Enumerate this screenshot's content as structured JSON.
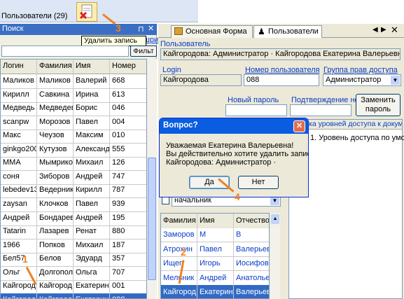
{
  "toolbar": {
    "delete_icon": "delete-record-icon"
  },
  "tooltip": "Удалить запись",
  "search_panel": {
    "title": "Поиск",
    "users_count": "Пользователи (29)",
    "font_link": "шрифт",
    "filter_value": "",
    "filter_button": "Фильт",
    "columns": [
      "Логин",
      "Фамилия",
      "Имя",
      "Номер"
    ],
    "rows": [
      [
        "Маликов",
        "Маликов",
        "Валерий",
        "668"
      ],
      [
        "Кирилл",
        "Савкина",
        "Ирина",
        "613"
      ],
      [
        "Медведь",
        "Медведев",
        "Борис",
        "046"
      ],
      [
        "scanpw",
        "Морозов",
        "Павел",
        "004"
      ],
      [
        "Макс",
        "Чеузов",
        "Максим",
        "010"
      ],
      [
        "ginkgo200",
        "Кутузов",
        "Александр",
        "555"
      ],
      [
        "MMA",
        "Мымрико",
        "Михаил",
        "126"
      ],
      [
        "соня",
        "Зиборов",
        "Андрей",
        "747"
      ],
      [
        "lebedev13",
        "Ведерник",
        "Кирилл",
        "787"
      ],
      [
        "zaysan",
        "Клочков",
        "Павел",
        "939"
      ],
      [
        "Андрей",
        "Бондарев",
        "Андрей",
        "195"
      ],
      [
        "Tatarin",
        "Лазарев",
        "Ренат",
        "880"
      ],
      [
        "1966",
        "Попков",
        "Михаил",
        "187"
      ],
      [
        "Бел57",
        "Белов",
        "Эдуард",
        "357"
      ],
      [
        "Ольг",
        "Долгопол",
        "Ольга",
        "707"
      ],
      [
        "Кайгород",
        "Кайгород",
        "Екатерин",
        "001"
      ],
      [
        "Кайгород",
        "Кайгород",
        "Екатерин",
        "088"
      ]
    ]
  },
  "tabs": [
    {
      "label": "Основная Форма"
    },
    {
      "label": "Пользователи"
    }
  ],
  "users_form": {
    "section_label": "Пользователь",
    "user_summary": "Кайгородова: Администратор · Кайгородова Екатерина Валерьевна",
    "login_label": "Login",
    "login_value": "Кайгородова",
    "number_label": "Номер пользователя",
    "number_value": "088",
    "group_label": "Группа прав доступа",
    "group_value": "Администратор",
    "new_password_label": "Новый пароль",
    "confirm_password_label": "Подтверждение но",
    "change_password_button": "Заменить пароль",
    "access_levels_header": "ка уровней доступа к докум",
    "access_level_item": "1. Уровень доступа по умолча",
    "position_value": "начальник",
    "staff_columns": [
      "Фамилия",
      "Имя",
      "Отчество"
    ],
    "staff_rows": [
      [
        "Заморов",
        "М",
        "В"
      ],
      [
        "Атрохин",
        "Павел",
        "Валерьев"
      ],
      [
        "Ищег",
        "Игорь",
        "Иосифов"
      ],
      [
        "Мельник",
        "Андрей",
        "Анатолье"
      ],
      [
        "Кайгород",
        "Екатерин",
        "Валерьев"
      ]
    ]
  },
  "dialog": {
    "title": "Вопрос?",
    "line1": "Уважаемая Екатерина Валерьевна!",
    "line2": "Вы действительно хотите удалить запись?",
    "line3": "Кайгородова: Администратор ·",
    "yes_button": "Да",
    "no_button": "Нет"
  },
  "step_markers": [
    "1",
    "2",
    "3",
    "4"
  ],
  "colors": {
    "selection": "#316ac5",
    "marker": "#f08020",
    "title_bar": "#0a5ce0"
  }
}
